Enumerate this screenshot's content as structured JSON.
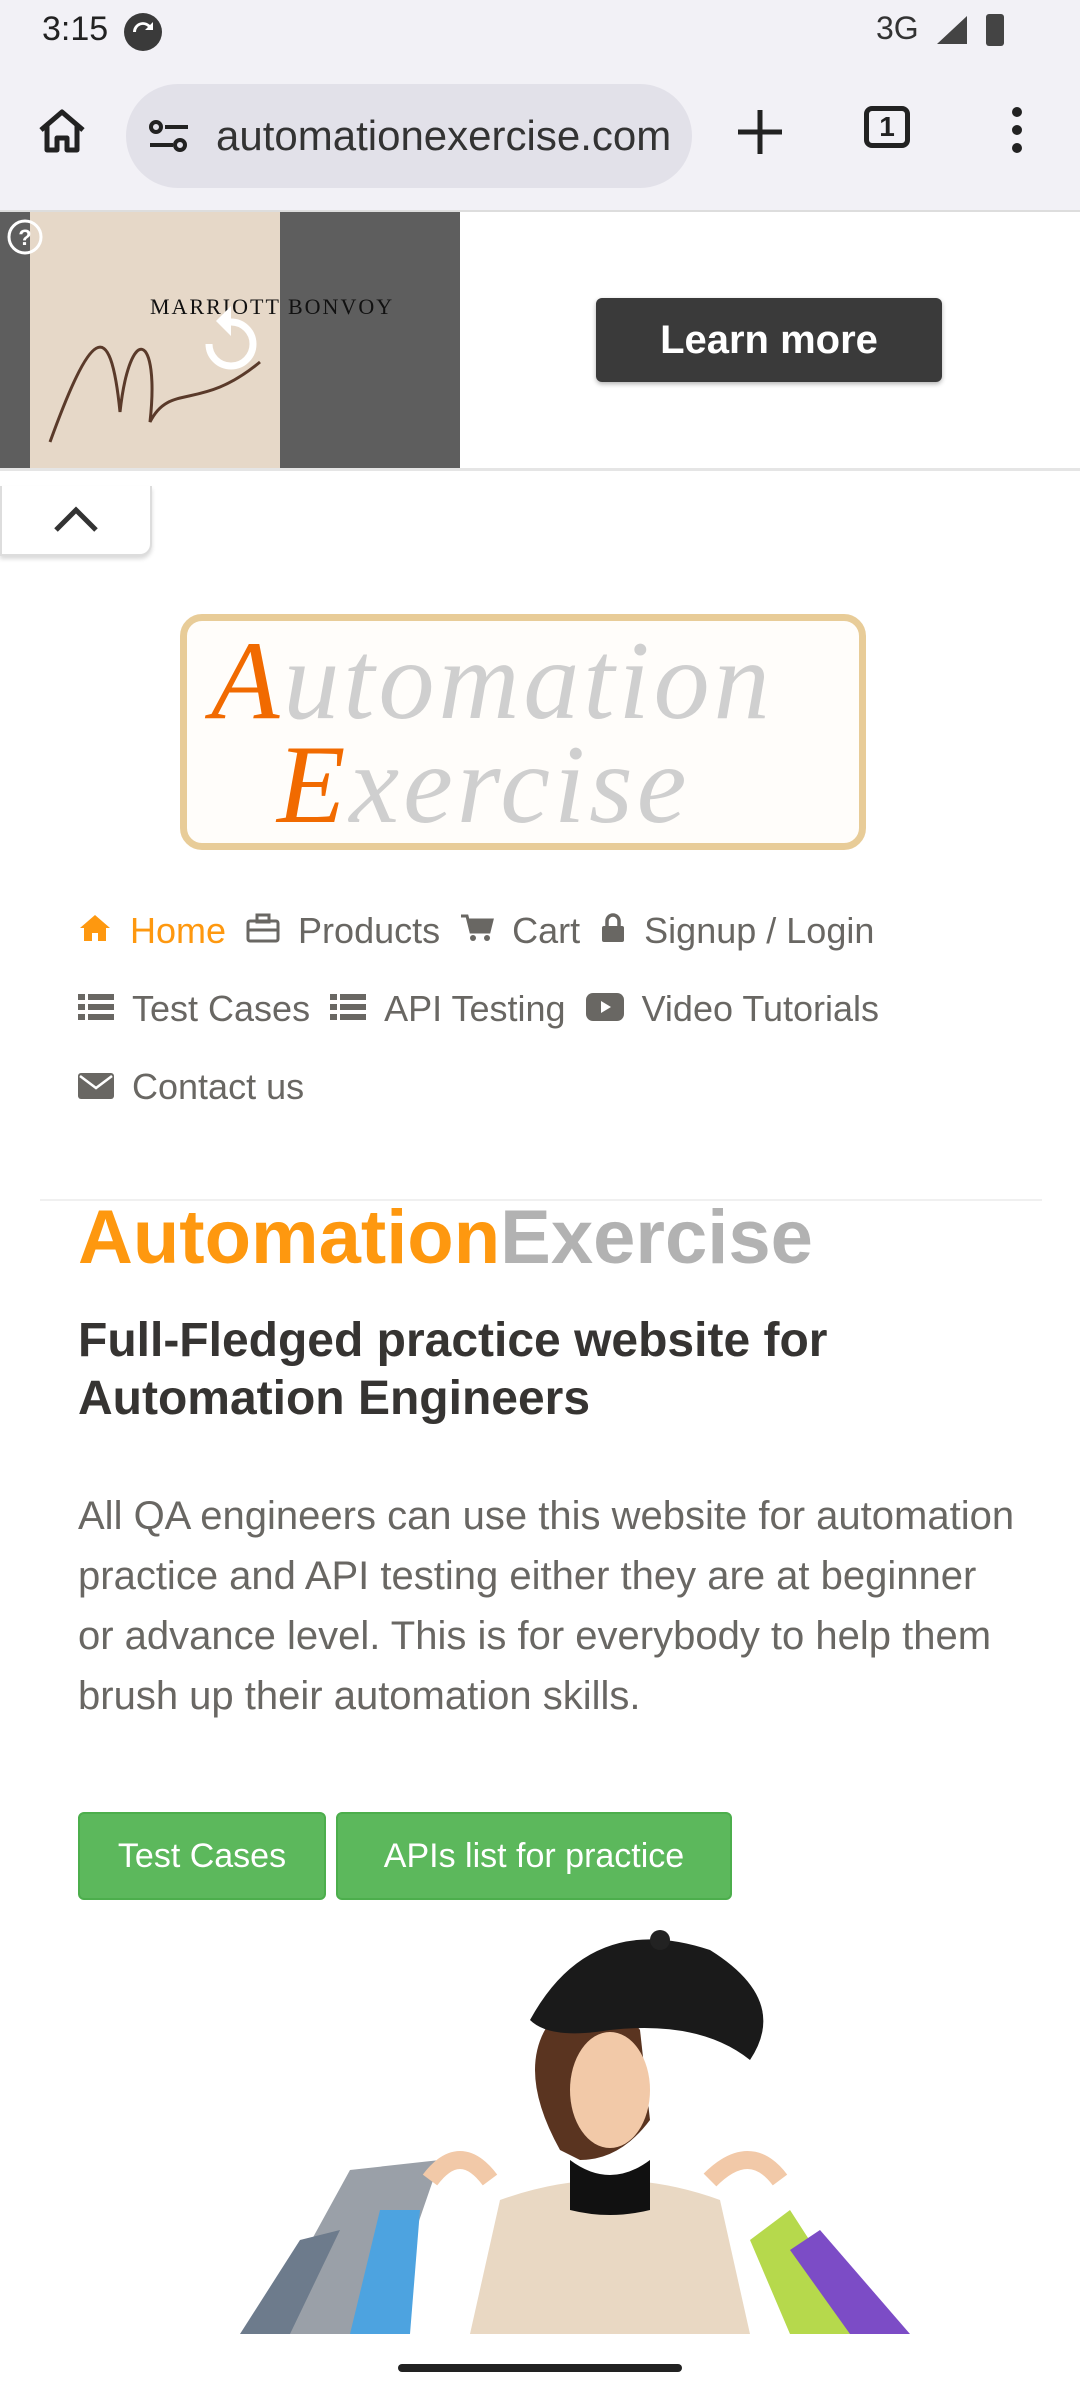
{
  "status_bar": {
    "time": "3:15",
    "network": "3G",
    "icons": [
      "sync-icon",
      "signal-icon",
      "battery-icon"
    ]
  },
  "browser": {
    "url": "automationexercise.com",
    "tab_count": "1",
    "icons": [
      "home-icon",
      "site-settings-icon",
      "new-tab-icon",
      "tab-switcher-icon",
      "more-menu-icon"
    ]
  },
  "ad": {
    "brand_text": "MARRIOTT BONVOY",
    "cta_label": "Learn more",
    "icons": [
      "ad-info-icon",
      "replay-icon",
      "collapse-chevron-icon"
    ]
  },
  "logo": {
    "line1_first": "A",
    "line1_rest": "utomation",
    "line2_first": "E",
    "line2_rest": "xercise"
  },
  "nav": {
    "items": [
      {
        "label": "Home",
        "icon": "home-icon",
        "active": true
      },
      {
        "label": "Products",
        "icon": "briefcase-icon"
      },
      {
        "label": "Cart",
        "icon": "cart-icon"
      },
      {
        "label": "Signup / Login",
        "icon": "lock-icon"
      },
      {
        "label": "Test Cases",
        "icon": "list-icon"
      },
      {
        "label": "API Testing",
        "icon": "list-icon"
      },
      {
        "label": "Video Tutorials",
        "icon": "youtube-play-icon"
      },
      {
        "label": "Contact us",
        "icon": "envelope-icon"
      }
    ]
  },
  "hero": {
    "brand_first": "Automation",
    "brand_second": "Exercise",
    "heading": "Full-Fledged practice website for Automation Engineers",
    "paragraph": "All QA engineers can use this website for automation practice and API testing either they are at beginner or advance level. This is for everybody to help them brush up their automation skills.",
    "buttons": {
      "test_cases": "Test Cases",
      "apis": "APIs list for practice"
    },
    "image": "girl-with-shopping-bags"
  },
  "colors": {
    "accent_orange": "#fe980f",
    "brand_gray": "#b2b2b2",
    "button_green": "#5cb85c",
    "ad_button": "#3a3a3a",
    "chrome_bg": "#f2f1f6"
  }
}
